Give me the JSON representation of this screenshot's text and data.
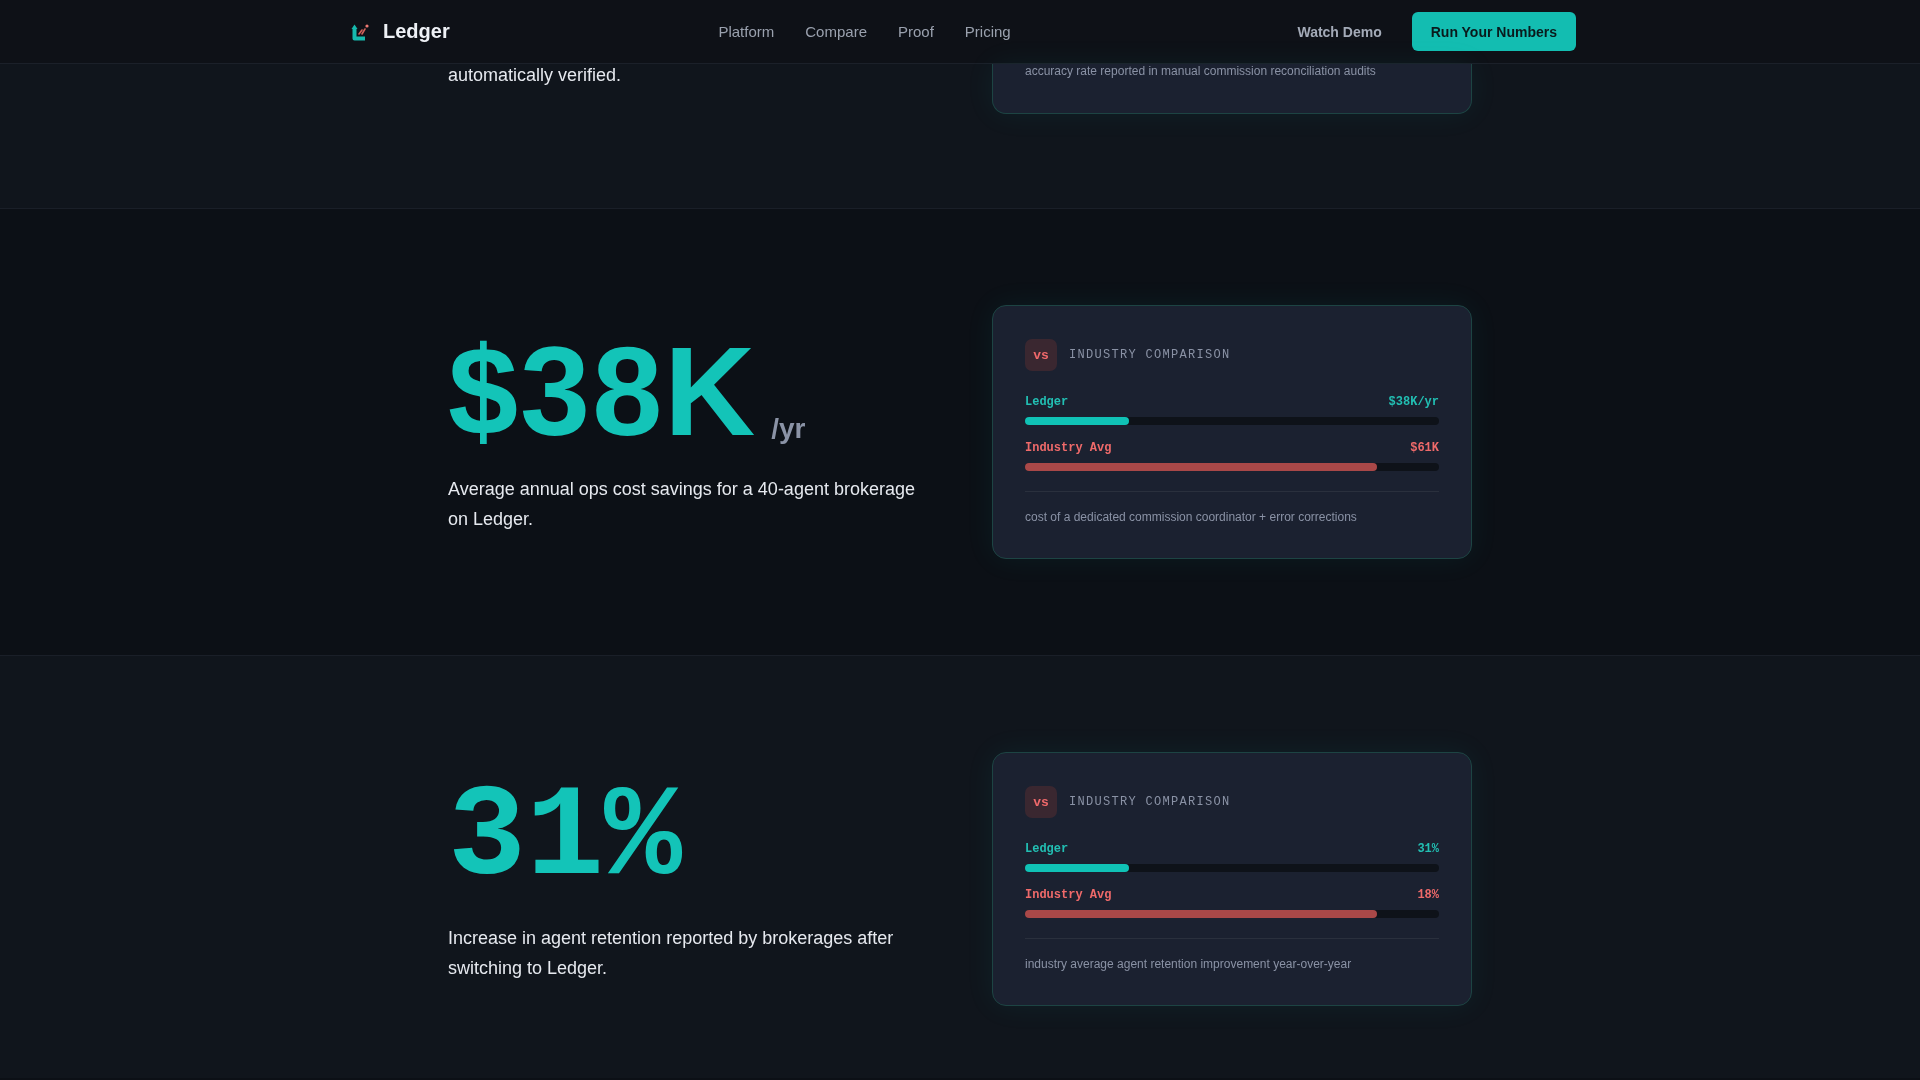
{
  "nav": {
    "brand": "Ledger",
    "links": [
      "Platform",
      "Compare",
      "Proof",
      "Pricing"
    ],
    "secondary_action": "Watch Demo",
    "primary_action": "Run Your Numbers"
  },
  "sections": [
    {
      "kind": "clipped",
      "description": "automatically verified.",
      "comparison": {
        "footnote": "accuracy rate reported in manual commission reconciliation audits"
      }
    },
    {
      "kind": "money",
      "value": "$38K",
      "unit": "/yr",
      "description": "Average annual ops cost savings for a 40-agent brokerage on Ledger.",
      "comparison": {
        "badge": "vs",
        "title": "INDUSTRY COMPARISON",
        "rows": [
          {
            "kind": "ours",
            "label": "Ledger",
            "value": "$38K/yr",
            "level": 0.25
          },
          {
            "kind": "industry",
            "label": "Industry Avg",
            "value": "$61K",
            "level": 0.85
          }
        ],
        "footnote": "cost of a dedicated commission coordinator + error corrections"
      }
    },
    {
      "kind": "percent",
      "value": "31%",
      "description": "Increase in agent retention reported by brokerages after switching to Ledger.",
      "comparison": {
        "badge": "vs",
        "title": "INDUSTRY COMPARISON",
        "rows": [
          {
            "kind": "ours",
            "label": "Ledger",
            "value": "31%",
            "level": 0.25
          },
          {
            "kind": "industry",
            "label": "Industry Avg",
            "value": "18%",
            "level": 0.85
          }
        ],
        "footnote": "industry average agent retention improvement year-over-year"
      }
    }
  ]
}
